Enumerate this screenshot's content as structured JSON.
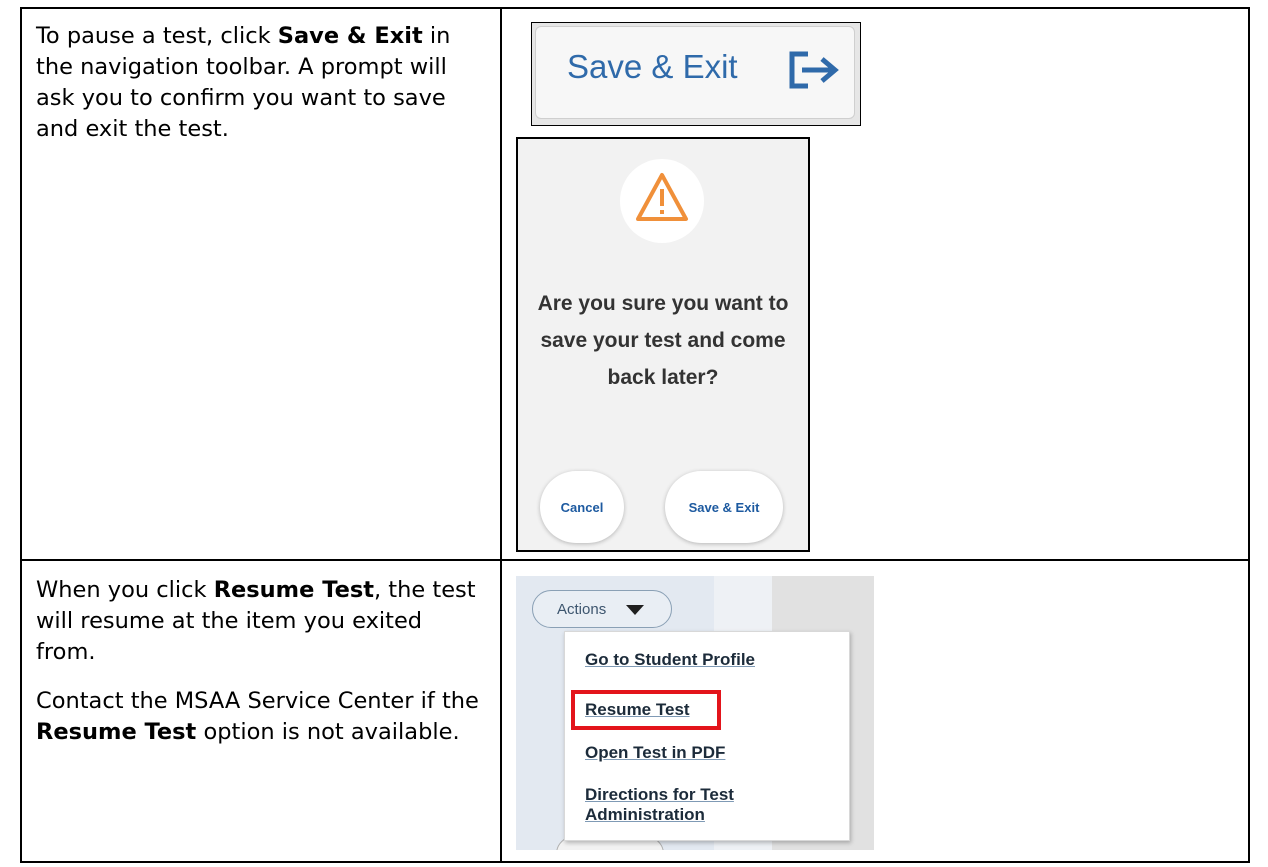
{
  "row1": {
    "text": {
      "before": "To pause a test, click ",
      "bold": "Save & Exit",
      "after": " in the navigation toolbar. A prompt will ask you to confirm you want to save and exit the test."
    },
    "save_button_label": "Save & Exit",
    "dialog": {
      "message": "Are you sure you want to save your test and come back later?",
      "cancel_label": "Cancel",
      "confirm_label": "Save & Exit"
    }
  },
  "row2": {
    "text1": {
      "before": "When you click ",
      "bold": "Resume Test",
      "after": ", the test will resume at the item you exited from."
    },
    "text2": {
      "before": "Contact the MSAA Service Center if the ",
      "bold": "Resume Test",
      "after": " option is not available."
    },
    "actions_label": "Actions",
    "menu_items": [
      "Go to Student Profile",
      "Resume Test",
      "Open Test in PDF",
      "Directions for Test Administration"
    ]
  },
  "icons": {
    "exit": "exit-arrow-icon",
    "warning": "warning-triangle-icon",
    "caret": "caret-down-icon"
  },
  "colors": {
    "link_blue": "#2f6aaa",
    "warning_orange": "#f0903a",
    "highlight_red": "#e3141b"
  }
}
